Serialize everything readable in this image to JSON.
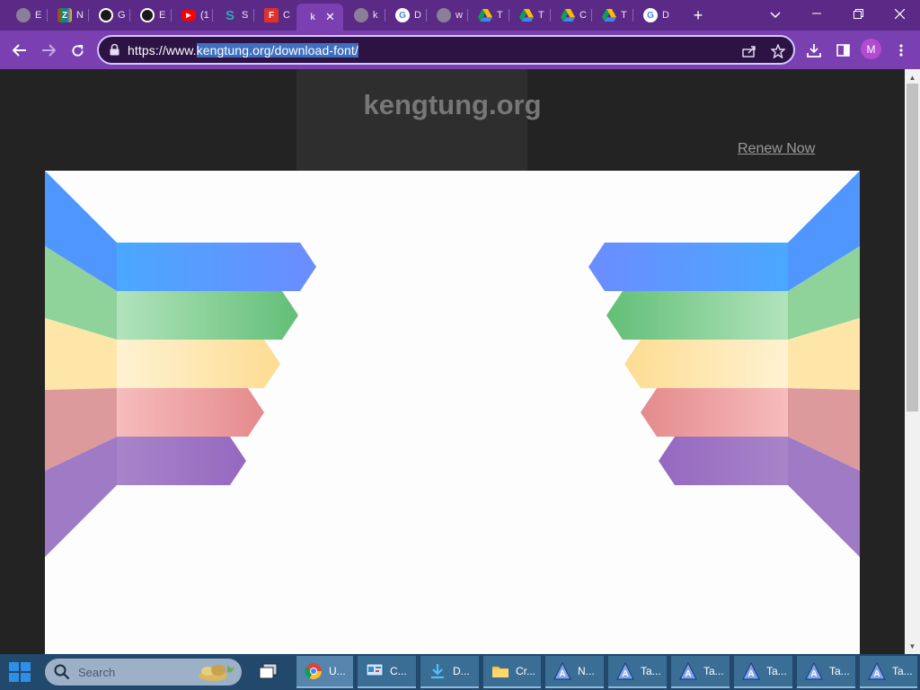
{
  "browser": {
    "tabs": [
      {
        "title": "E",
        "icon": "globe-icon",
        "color": "#8a7f99"
      },
      {
        "title": "N",
        "icon": "zoho-icon",
        "color": "#d4352b"
      },
      {
        "title": "G",
        "icon": "github-icon",
        "color": "#1a1a1a"
      },
      {
        "title": "E",
        "icon": "github-icon",
        "color": "#1a1a1a"
      },
      {
        "title": "(1",
        "icon": "youtube-icon",
        "color": "#ff0000"
      },
      {
        "title": "S",
        "icon": "s-logo-icon",
        "color": "#2aa9b8"
      },
      {
        "title": "C",
        "icon": "ef-icon",
        "color": "#e0312b"
      },
      {
        "title": "k",
        "icon": "cursor-icon",
        "color": "#9a9a9a",
        "active": true
      },
      {
        "title": "k",
        "icon": "globe-icon",
        "color": "#8a7f99"
      },
      {
        "title": "D",
        "icon": "google-icon",
        "color": "#ffffff"
      },
      {
        "title": "w",
        "icon": "globe-icon",
        "color": "#8a7f99"
      },
      {
        "title": "T",
        "icon": "google-drive-icon",
        "color": "#ffffff"
      },
      {
        "title": "T",
        "icon": "google-drive-icon",
        "color": "#ffffff"
      },
      {
        "title": "C",
        "icon": "google-drive-icon",
        "color": "#ffffff"
      },
      {
        "title": "T",
        "icon": "google-drive-icon",
        "color": "#ffffff"
      },
      {
        "title": "D",
        "icon": "google-icon",
        "color": "#ffffff"
      }
    ],
    "url_prefix": "https://www.",
    "url_selected": "kengtung.org/download-font/",
    "avatar_letter": "M",
    "theme_color": "#7a3fb0"
  },
  "page": {
    "site_title": "kengtung.org",
    "renew_link": "Renew Now"
  },
  "taskbar": {
    "search_placeholder": "Search",
    "apps": [
      {
        "label": "U...",
        "icon": "chrome-icon",
        "active": true
      },
      {
        "label": "C...",
        "icon": "control-panel-icon"
      },
      {
        "label": "D...",
        "icon": "download-icon"
      },
      {
        "label": "Cr...",
        "icon": "folder-icon"
      },
      {
        "label": "N...",
        "icon": "font-app-icon"
      },
      {
        "label": "Ta...",
        "icon": "font-app-icon"
      },
      {
        "label": "Ta...",
        "icon": "font-app-icon"
      },
      {
        "label": "Ta...",
        "icon": "font-app-icon"
      },
      {
        "label": "Ta...",
        "icon": "font-app-icon"
      },
      {
        "label": "Ta...",
        "icon": "font-app-icon"
      }
    ]
  }
}
